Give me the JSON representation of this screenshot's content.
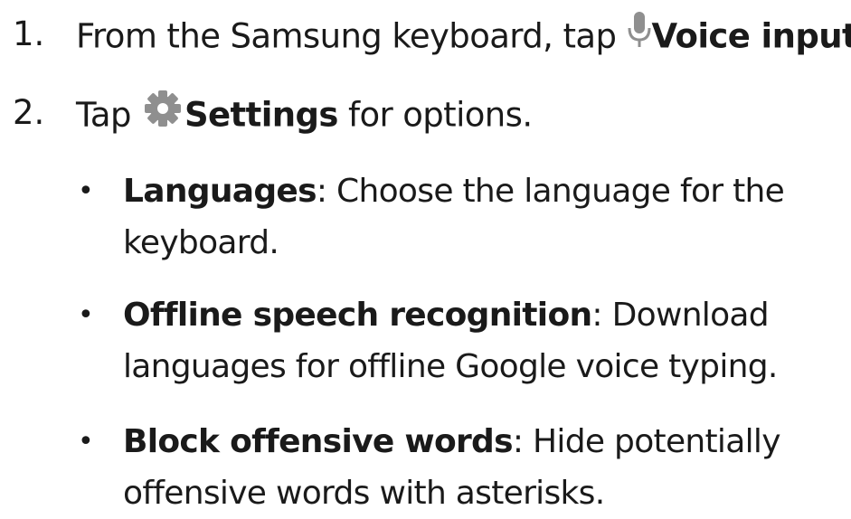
{
  "steps": [
    {
      "number": "1.",
      "before": "From the Samsung keyboard, tap ",
      "icon": "microphone-icon",
      "bold": "Voice input",
      "after": "."
    },
    {
      "number": "2.",
      "before": "Tap ",
      "icon": "gear-icon",
      "bold": "Settings",
      "after": " for options."
    }
  ],
  "options": [
    {
      "bullet": "•",
      "term": "Languages",
      "separator": ":",
      "line1": " Choose the language for the",
      "line2": "keyboard."
    },
    {
      "bullet": "•",
      "term": "Offline speech recognition",
      "separator": ":",
      "line1": " Download",
      "line2": "languages for offline Google voice typing."
    },
    {
      "bullet": "•",
      "term": "Block offensive words",
      "separator": ":",
      "line1": " Hide potentially",
      "line2": "offensive words with asterisks."
    }
  ],
  "colors": {
    "text": "#1a1a1a",
    "icon": "#8f8f8f"
  }
}
